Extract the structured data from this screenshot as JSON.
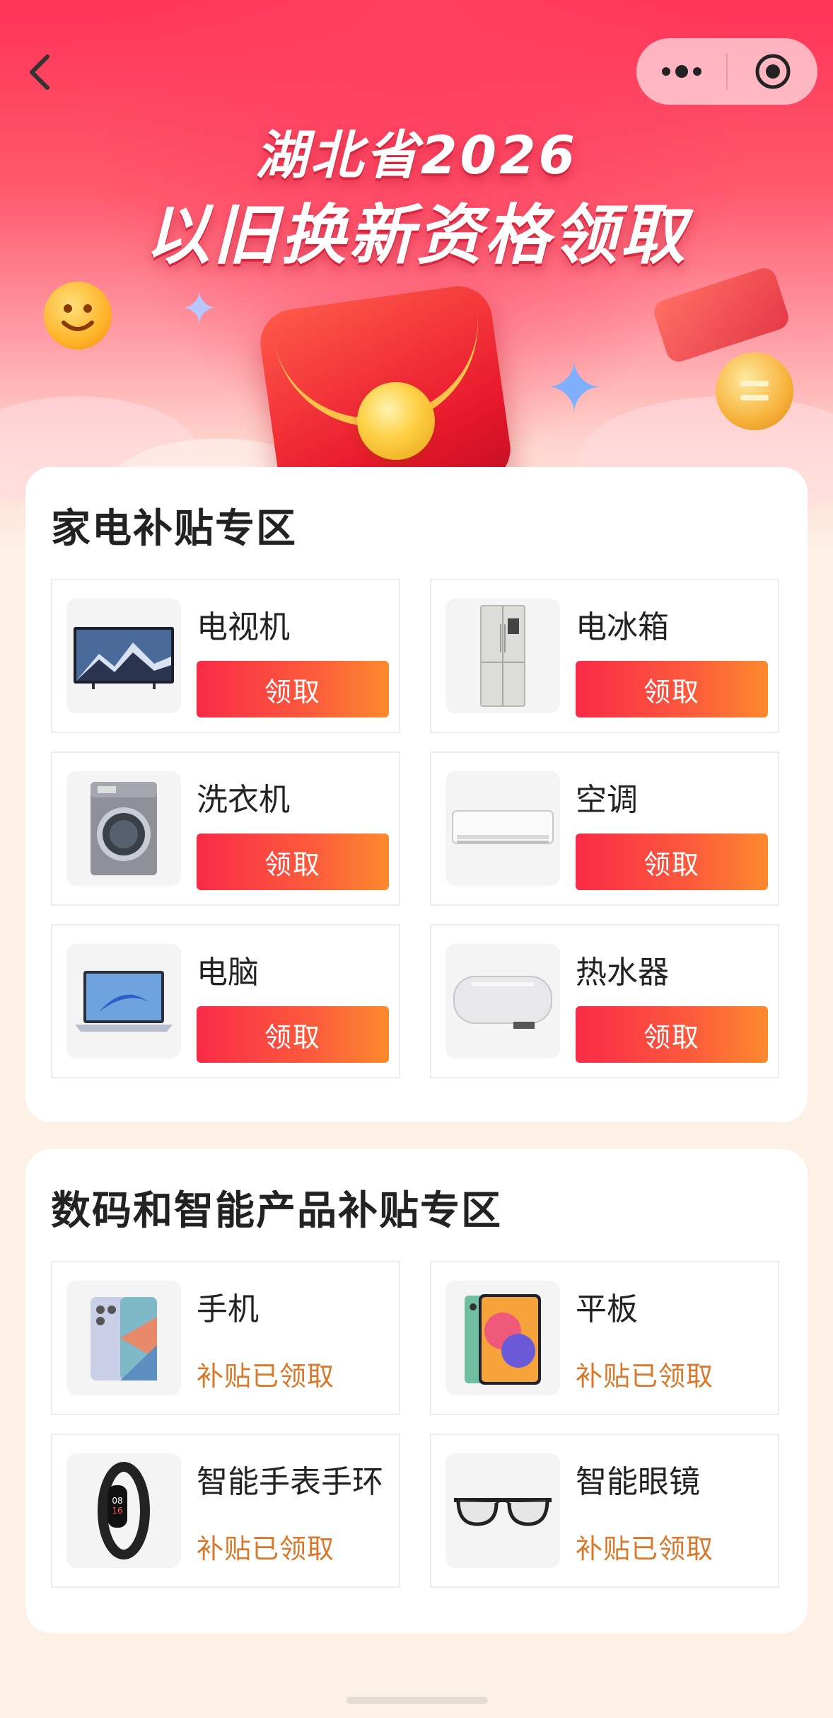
{
  "header": {
    "title_line1": "湖北省2026",
    "title_line2": "以旧换新资格领取"
  },
  "sections": [
    {
      "title": "家电补贴专区",
      "items": [
        {
          "name": "电视机",
          "action": "领取",
          "icon": "tv-icon"
        },
        {
          "name": "电冰箱",
          "action": "领取",
          "icon": "fridge-icon"
        },
        {
          "name": "洗衣机",
          "action": "领取",
          "icon": "washing-machine-icon"
        },
        {
          "name": "空调",
          "action": "领取",
          "icon": "air-conditioner-icon"
        },
        {
          "name": "电脑",
          "action": "领取",
          "icon": "laptop-icon"
        },
        {
          "name": "热水器",
          "action": "领取",
          "icon": "water-heater-icon"
        }
      ]
    },
    {
      "title": "数码和智能产品补贴专区",
      "items": [
        {
          "name": "手机",
          "status": "补贴已领取",
          "icon": "phone-icon"
        },
        {
          "name": "平板",
          "status": "补贴已领取",
          "icon": "tablet-icon"
        },
        {
          "name": "智能手表手环",
          "status": "补贴已领取",
          "icon": "smart-band-icon"
        },
        {
          "name": "智能眼镜",
          "status": "补贴已领取",
          "icon": "smart-glasses-icon"
        }
      ]
    }
  ],
  "colors": {
    "accent": "#f92a47",
    "accent_end": "#fd8a2e",
    "claimed_text": "#d9782a"
  }
}
